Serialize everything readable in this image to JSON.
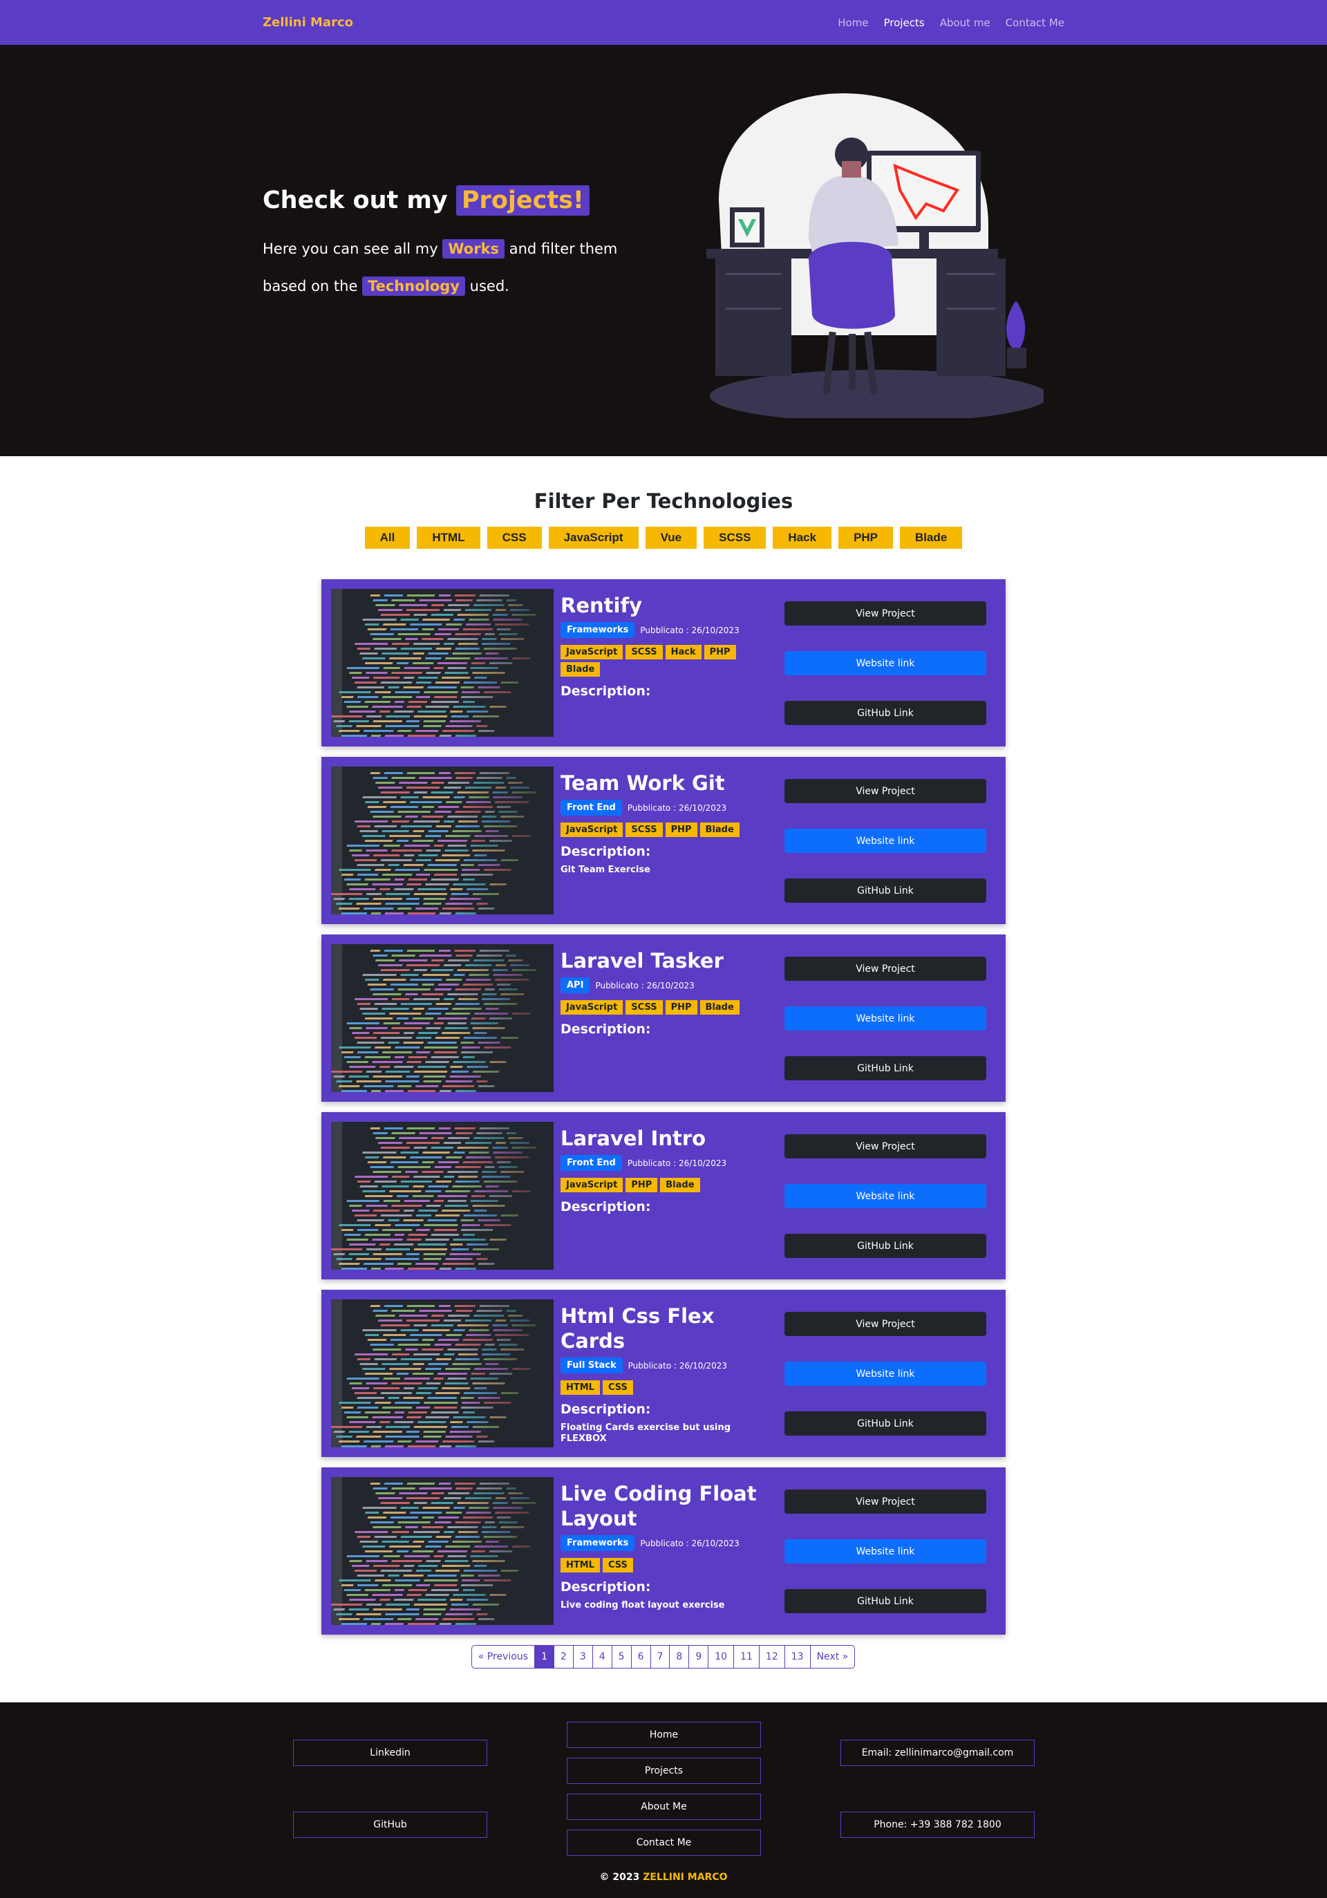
{
  "nav": {
    "brand": "Zellini Marco",
    "links": [
      {
        "label": "Home",
        "active": false
      },
      {
        "label": "Projects",
        "active": true
      },
      {
        "label": "About me",
        "active": false
      },
      {
        "label": "Contact Me",
        "active": false
      }
    ]
  },
  "hero": {
    "title_pre": "Check out my",
    "title_hl": "Projects!",
    "line1_pre": "Here you can see all my",
    "line1_hl": "Works",
    "line1_post": "and filter them",
    "line2_pre": "based on the",
    "line2_hl": "Technology",
    "line2_post": "used."
  },
  "filter": {
    "title": "Filter Per Technologies",
    "options": [
      "All",
      "HTML",
      "CSS",
      "JavaScript",
      "Vue",
      "SCSS",
      "Hack",
      "PHP",
      "Blade"
    ]
  },
  "projects": [
    {
      "title": "Rentify",
      "type": "Frameworks",
      "published": "Pubblicato : 26/10/2023",
      "tags": [
        "JavaScript",
        "SCSS",
        "Hack",
        "PHP",
        "Blade"
      ],
      "description_label": "Description:",
      "description": ""
    },
    {
      "title": "Team Work Git",
      "type": "Front End",
      "published": "Pubblicato : 26/10/2023",
      "tags": [
        "JavaScript",
        "SCSS",
        "PHP",
        "Blade"
      ],
      "description_label": "Description:",
      "description": "Git Team Exercise"
    },
    {
      "title": "Laravel Tasker",
      "type": "API",
      "published": "Pubblicato : 26/10/2023",
      "tags": [
        "JavaScript",
        "SCSS",
        "PHP",
        "Blade"
      ],
      "description_label": "Description:",
      "description": ""
    },
    {
      "title": "Laravel Intro",
      "type": "Front End",
      "published": "Pubblicato : 26/10/2023",
      "tags": [
        "JavaScript",
        "PHP",
        "Blade"
      ],
      "description_label": "Description:",
      "description": ""
    },
    {
      "title": "Html Css Flex Cards",
      "type": "Full Stack",
      "published": "Pubblicato : 26/10/2023",
      "tags": [
        "HTML",
        "CSS"
      ],
      "description_label": "Description:",
      "description": "Floating Cards exercise but using FLEXBOX"
    },
    {
      "title": "Live Coding Float Layout",
      "type": "Frameworks",
      "published": "Pubblicato : 26/10/2023",
      "tags": [
        "HTML",
        "CSS"
      ],
      "description_label": "Description:",
      "description": "Live coding float layout exercise"
    }
  ],
  "card_actions": {
    "view": "View Project",
    "website": "Website link",
    "github": "GitHub Link"
  },
  "pagination": {
    "prev": "« Previous",
    "pages": [
      "1",
      "2",
      "3",
      "4",
      "5",
      "6",
      "7",
      "8",
      "9",
      "10",
      "11",
      "12",
      "13"
    ],
    "current": "1",
    "next": "Next »"
  },
  "footer": {
    "linkedin": "Linkedin",
    "github": "GitHub",
    "home": "Home",
    "projects": "Projects",
    "about": "About Me",
    "contact": "Contact Me",
    "email": "Email: zellinimarco@gmail.com",
    "phone": "Phone: +39 388 782 1800",
    "copyright_pre": "© 2023",
    "copyright_name": "ZELLINI MARCO"
  },
  "colors": {
    "primary": "#5b3cc4",
    "accent": "#f6b800",
    "dark": "#151111",
    "link_blue": "#0d6efd"
  }
}
